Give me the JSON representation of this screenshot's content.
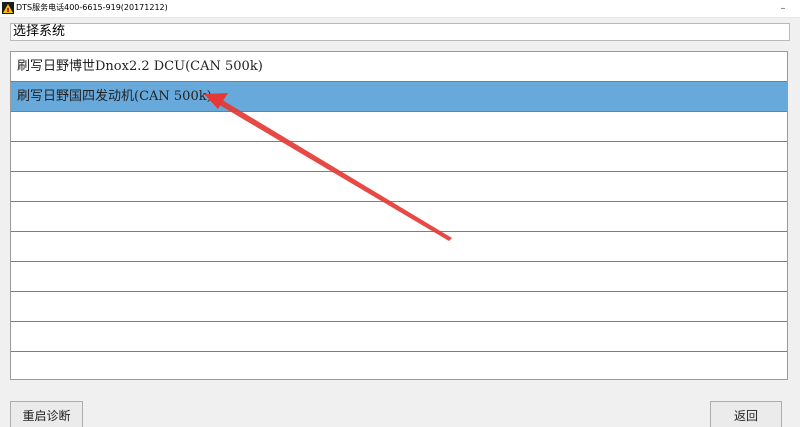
{
  "window": {
    "title": "DTS服务电话400-6615-919(20171212)",
    "minimize_glyph": "–",
    "app_icon": "dts-app-icon"
  },
  "header": {
    "title": "选择系统"
  },
  "list": {
    "items": [
      {
        "label": "刷写日野博世Dnox2.2 DCU(CAN 500k)",
        "selected": false
      },
      {
        "label": "刷写日野国四发动机(CAN 500k)",
        "selected": true
      },
      {
        "label": "",
        "selected": false
      },
      {
        "label": "",
        "selected": false
      },
      {
        "label": "",
        "selected": false
      },
      {
        "label": "",
        "selected": false
      },
      {
        "label": "",
        "selected": false
      },
      {
        "label": "",
        "selected": false
      },
      {
        "label": "",
        "selected": false
      },
      {
        "label": "",
        "selected": false
      },
      {
        "label": "",
        "selected": false
      }
    ],
    "selected_color": "#68a9dc"
  },
  "buttons": {
    "restart_label": "重启诊断",
    "back_label": "返回"
  },
  "annotation": {
    "arrow_color": "#e53935"
  }
}
